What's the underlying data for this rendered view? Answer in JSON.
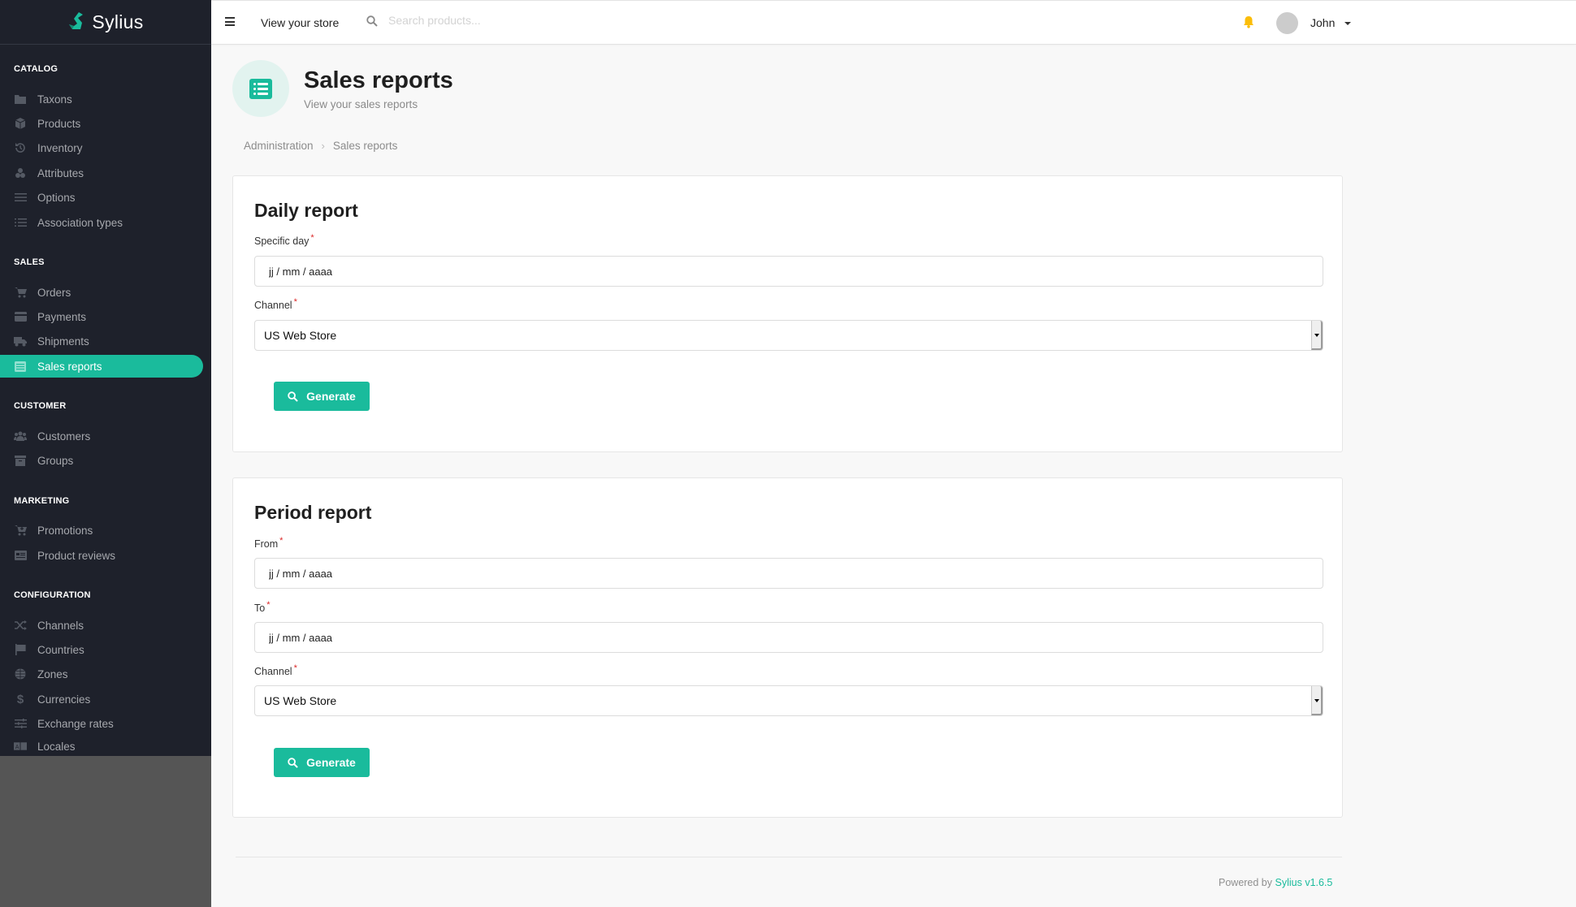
{
  "app": {
    "logo_text": "Sylius",
    "brand_color": "#1abb9c"
  },
  "sidebar": {
    "sections": [
      {
        "title": "CATALOG",
        "items": [
          {
            "label": "Taxons",
            "icon": "folder-icon"
          },
          {
            "label": "Products",
            "icon": "cube-icon"
          },
          {
            "label": "Inventory",
            "icon": "history-icon"
          },
          {
            "label": "Attributes",
            "icon": "cubes-icon"
          },
          {
            "label": "Options",
            "icon": "sliders-icon"
          },
          {
            "label": "Association types",
            "icon": "tasks-icon"
          }
        ]
      },
      {
        "title": "SALES",
        "items": [
          {
            "label": "Orders",
            "icon": "cart-icon"
          },
          {
            "label": "Payments",
            "icon": "credit-card-icon"
          },
          {
            "label": "Shipments",
            "icon": "truck-icon"
          },
          {
            "label": "Sales reports",
            "icon": "table-icon",
            "active": true
          }
        ]
      },
      {
        "title": "CUSTOMER",
        "items": [
          {
            "label": "Customers",
            "icon": "users-icon"
          },
          {
            "label": "Groups",
            "icon": "archive-icon"
          }
        ]
      },
      {
        "title": "MARKETING",
        "items": [
          {
            "label": "Promotions",
            "icon": "cart-plus-icon"
          },
          {
            "label": "Product reviews",
            "icon": "newspaper-icon"
          }
        ]
      },
      {
        "title": "CONFIGURATION",
        "items": [
          {
            "label": "Channels",
            "icon": "shuffle-icon"
          },
          {
            "label": "Countries",
            "icon": "flag-icon"
          },
          {
            "label": "Zones",
            "icon": "globe-icon"
          },
          {
            "label": "Currencies",
            "icon": "dollar-icon"
          },
          {
            "label": "Exchange rates",
            "icon": "sliders-icon"
          },
          {
            "label": "Locales",
            "icon": "language-icon"
          }
        ]
      }
    ]
  },
  "topbar": {
    "view_store": "View your store",
    "search_placeholder": "Search products...",
    "user_name": "John"
  },
  "header": {
    "title": "Sales reports",
    "subtitle": "View your sales reports",
    "breadcrumb": [
      "Administration",
      "Sales reports"
    ]
  },
  "daily_report": {
    "title": "Daily report",
    "specific_day_label": "Specific day",
    "specific_day_value": "jj / mm / aaaa",
    "channel_label": "Channel",
    "channel_value": "US Web Store",
    "button_label": "Generate"
  },
  "period_report": {
    "title": "Period report",
    "from_label": "From",
    "from_value": "jj / mm / aaaa",
    "to_label": "To",
    "to_value": "jj / mm / aaaa",
    "channel_label": "Channel",
    "channel_value": "US Web Store",
    "button_label": "Generate"
  },
  "footer": {
    "powered_by": "Powered by",
    "link_text": "Sylius v1.6.5"
  }
}
